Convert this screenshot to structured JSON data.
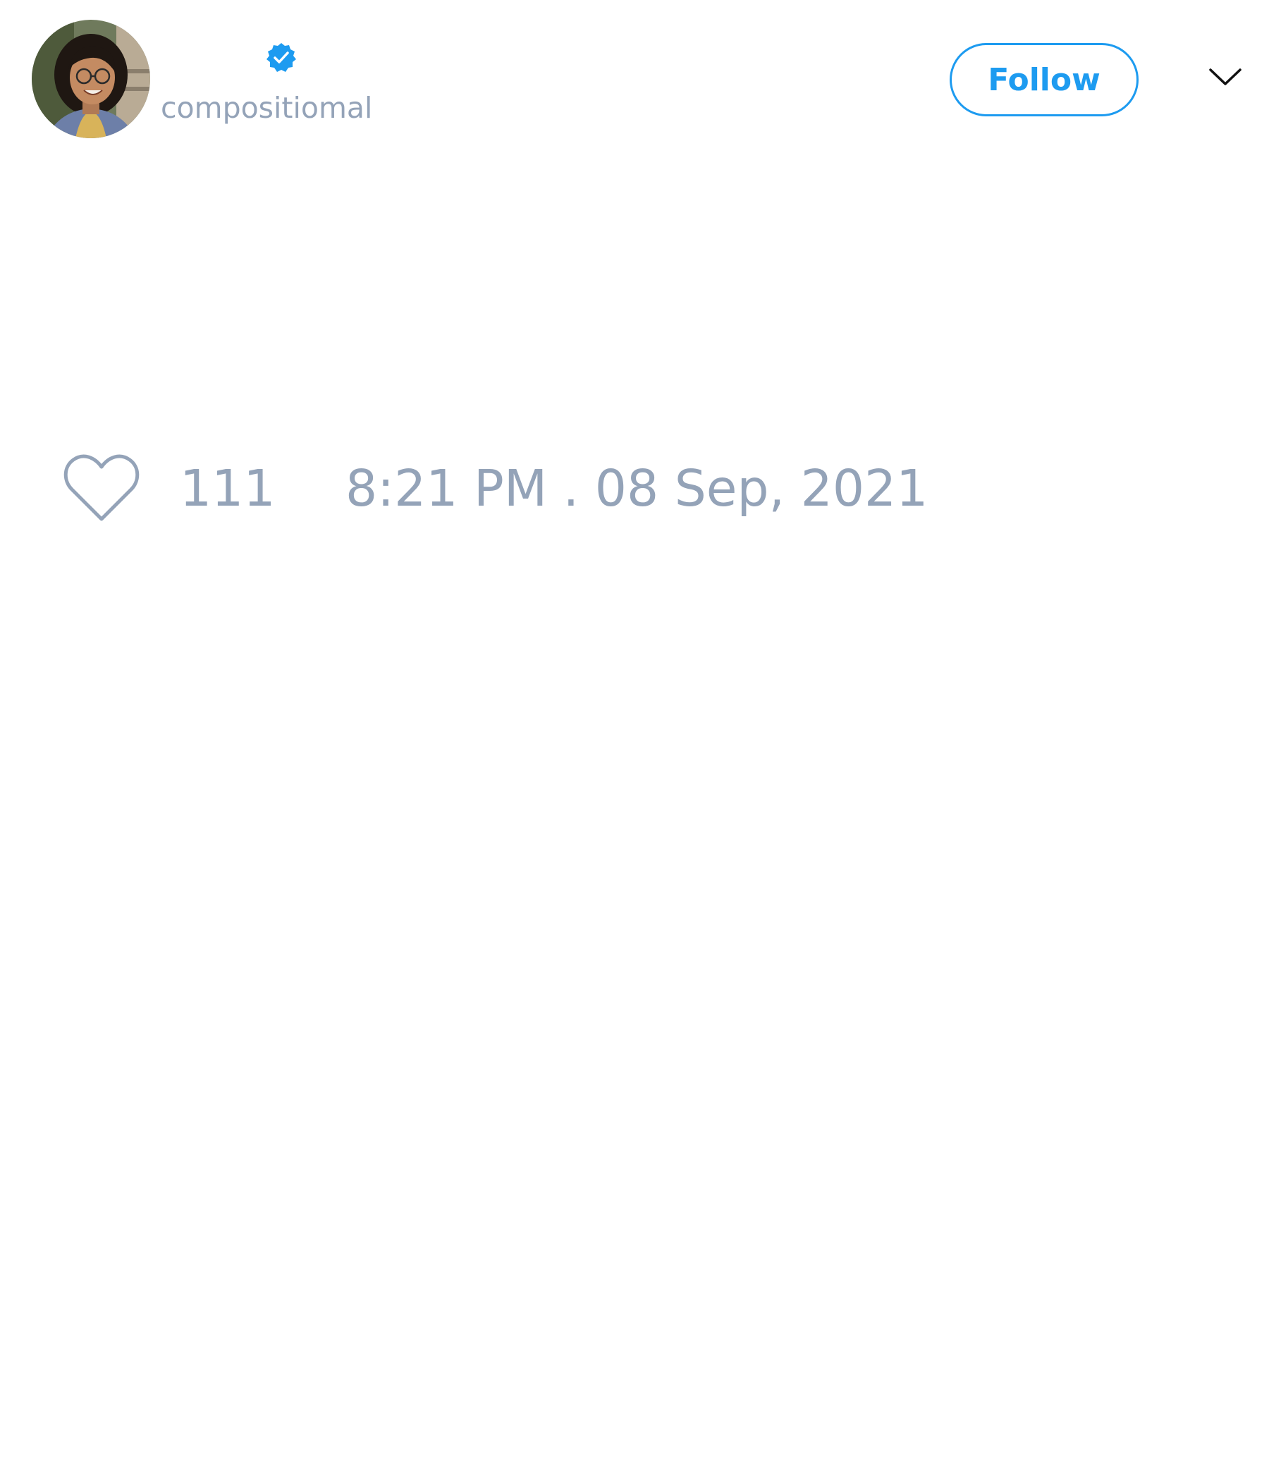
{
  "author": {
    "handle": "compositiomal",
    "verified": true,
    "avatar_description": "photo-avatar"
  },
  "actions": {
    "follow_label": "Follow",
    "menu_icon": "chevron-down-icon"
  },
  "engagement": {
    "like_icon": "heart-outline-icon",
    "like_count": "111",
    "timestamp": "8:21 PM . 08 Sep, 2021"
  },
  "colors": {
    "accent": "#1d9bf0",
    "muted_text": "#94a3b8",
    "background": "#ffffff"
  }
}
